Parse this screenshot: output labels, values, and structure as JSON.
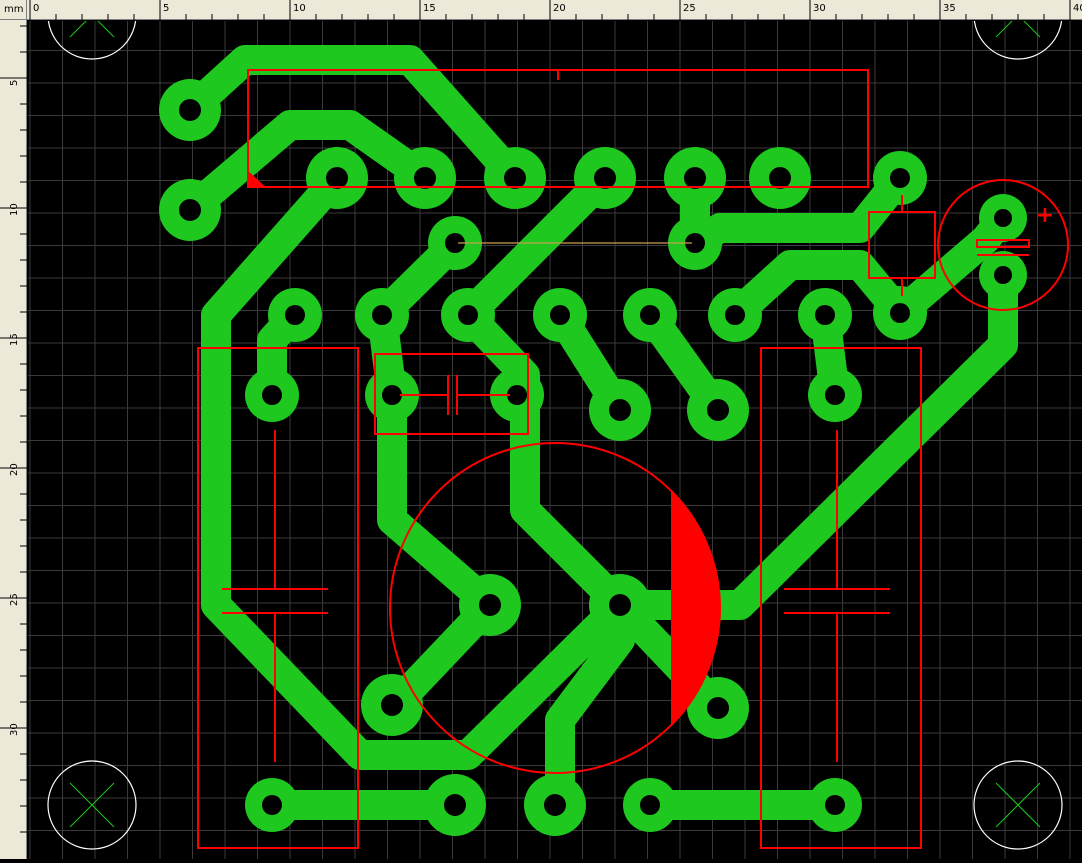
{
  "ruler": {
    "unit_label": "mm",
    "x_labels": [
      "0",
      "5",
      "10",
      "15",
      "20",
      "25",
      "30",
      "35",
      "40"
    ],
    "y_labels": [
      "5",
      "10",
      "15",
      "20",
      "25",
      "30"
    ]
  },
  "colors": {
    "ruler_bg": "#ece9d8",
    "board_bg": "#000000",
    "grid": "#3a3a3a",
    "copper": "#1ec81e",
    "silkscreen": "#ff0000",
    "mount_hole": "#ffffff",
    "mount_cross": "#1ec81e",
    "jumper": "#c8a050"
  },
  "silkscreen": {
    "polarity_mark": "+"
  }
}
